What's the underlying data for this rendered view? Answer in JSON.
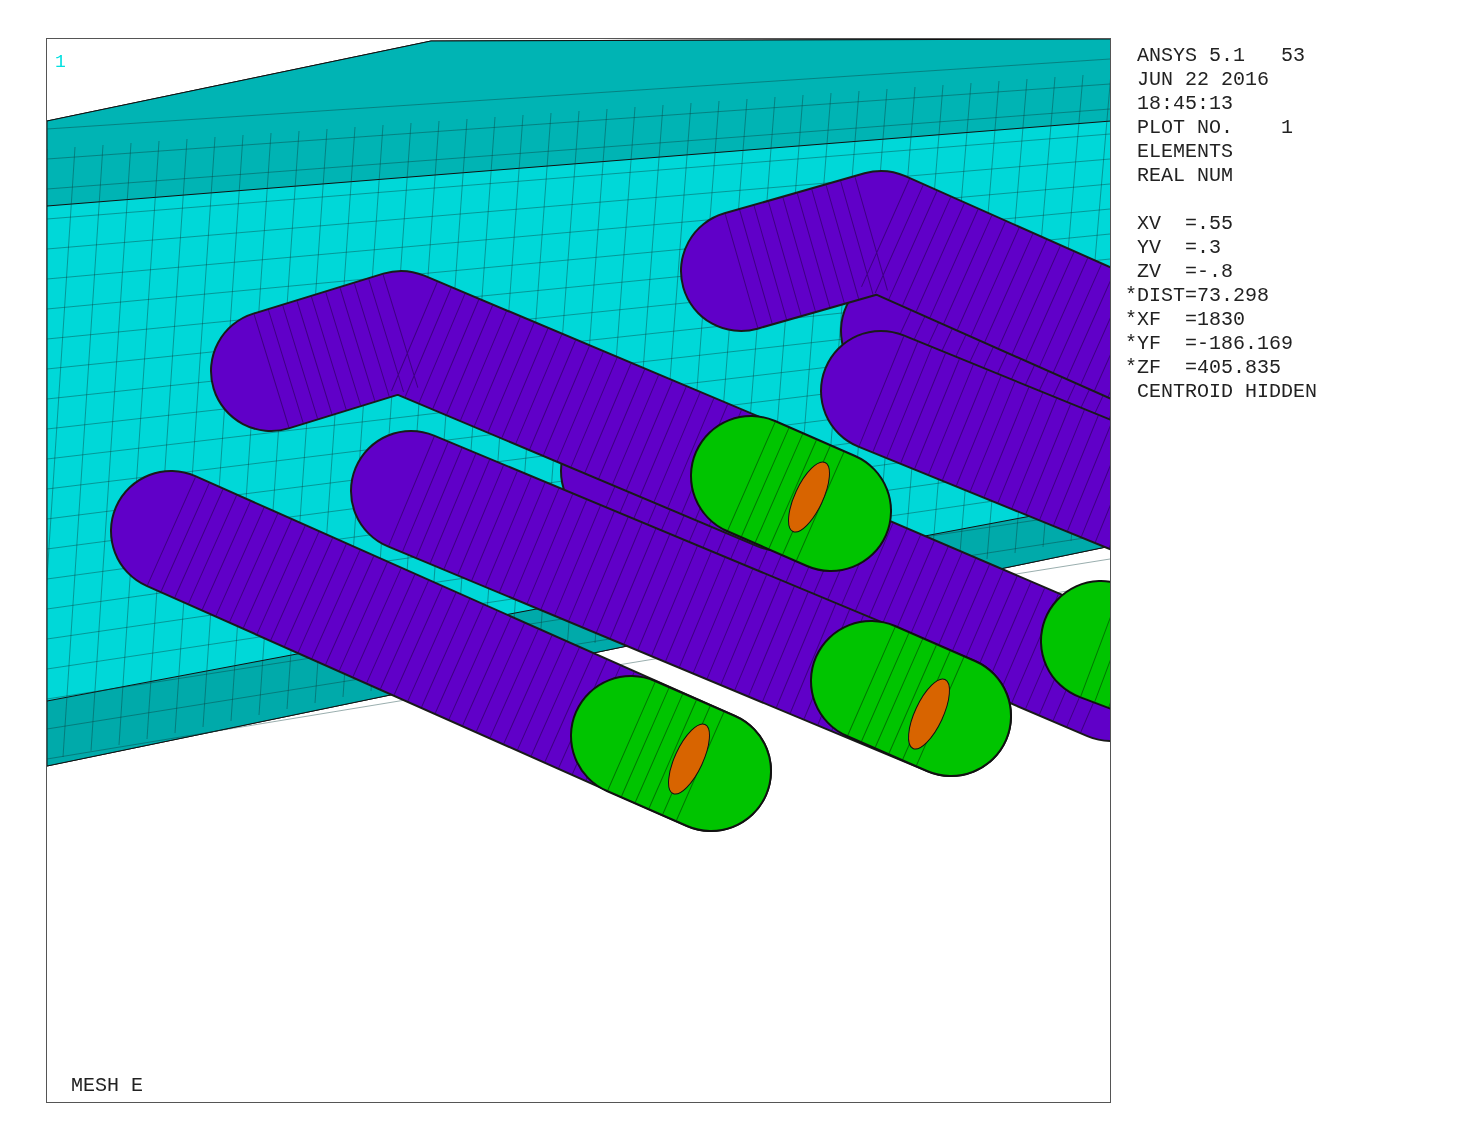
{
  "viewport": {
    "window_number": "1",
    "footer_label": "MESH E"
  },
  "legend": {
    "header_lines": [
      "ANSYS 5.1   53",
      "JUN 22 2016",
      "18:45:13",
      "PLOT NO.    1",
      "ELEMENTS",
      "REAL NUM"
    ],
    "view_lines": [
      " XV  =.55",
      " YV  =.3",
      " ZV  =-.8",
      "*DIST=73.298",
      "*XF  =1830",
      "*YF  =-186.169",
      "*ZF  =405.835",
      " CENTROID HIDDEN"
    ]
  }
}
